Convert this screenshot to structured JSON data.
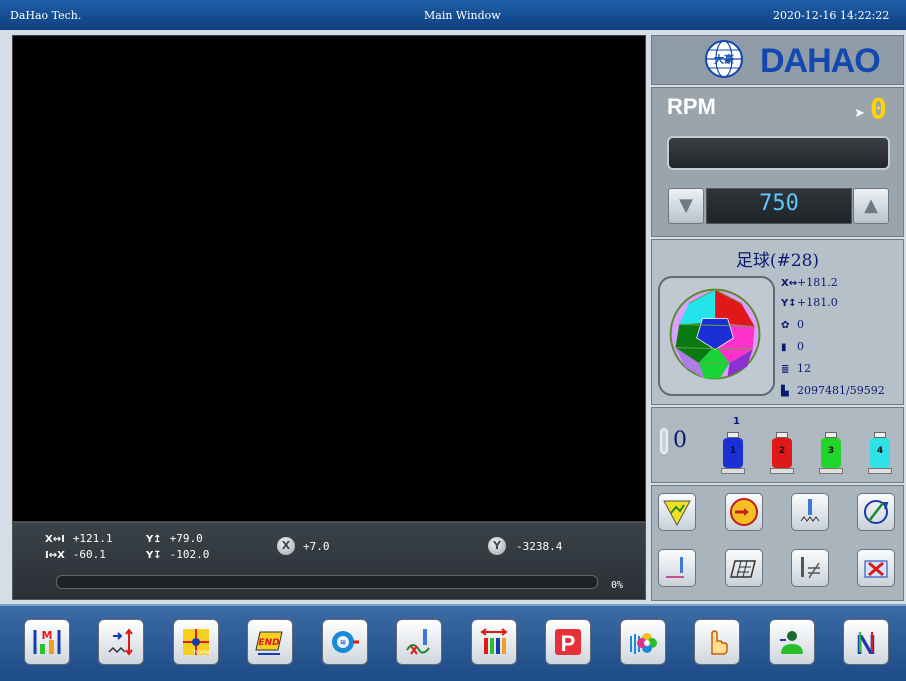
{
  "window": {
    "left_title": "DaHao Tech.",
    "center_title": "Main Window",
    "datetime": "2020-12-16 14:22:22"
  },
  "logo": {
    "brand": "DAHAO",
    "emblem_text": "大豪"
  },
  "rpm": {
    "label": "RPM",
    "current": "0",
    "setpoint": "750",
    "down_icon": "triangle-down-icon",
    "up_icon": "triangle-up-icon"
  },
  "coords": {
    "x_pos_label": "X↔I",
    "x_pos": "+121.1",
    "x_neg_label": "I↔X",
    "x_neg": "-60.1",
    "y_pos_label": "Y↥",
    "y_pos": "+79.0",
    "y_neg_label": "Y↧",
    "y_neg": "-102.0",
    "x_axis_label": "X",
    "x_axis": "+7.0",
    "y_axis_label": "Y",
    "y_axis": "-3238.4",
    "progress_percent": "0%",
    "progress": 0
  },
  "design": {
    "title": "足球(#28)",
    "width": "+181.2",
    "height": "+181.0",
    "color_changes": "0",
    "stops": "0",
    "colors": "12",
    "stitches": "2097481/59592"
  },
  "needles": {
    "current": "0",
    "current_marker": "1",
    "spools": [
      {
        "n": "1",
        "color": "#1a2fd6"
      },
      {
        "n": "2",
        "color": "#e01818"
      },
      {
        "n": "3",
        "color": "#21d42a"
      },
      {
        "n": "4",
        "color": "#2fe0e6"
      }
    ]
  },
  "tools": [
    "frame-trace-icon",
    "speed-dial-icon",
    "needle-stitch-icon",
    "rotate-disable-icon",
    "needle-down-icon",
    "frame-pattern-icon",
    "needle-not-equal-icon",
    "delete-frame-icon"
  ],
  "toolbar": [
    "memory-manage-icon",
    "stitch-adjust-icon",
    "home-icon",
    "end-icon",
    "color-sequence-icon",
    "trim-icon",
    "needle-settings-icon",
    "parameter-icon",
    "pattern-flower-icon",
    "hand-icon",
    "user-icon",
    "needle-n-icon"
  ],
  "toolbar_labels": {
    "home_text": "home",
    "end_text": "END",
    "param_text": "P",
    "needle_n_text": "N",
    "memory_text": "M"
  }
}
